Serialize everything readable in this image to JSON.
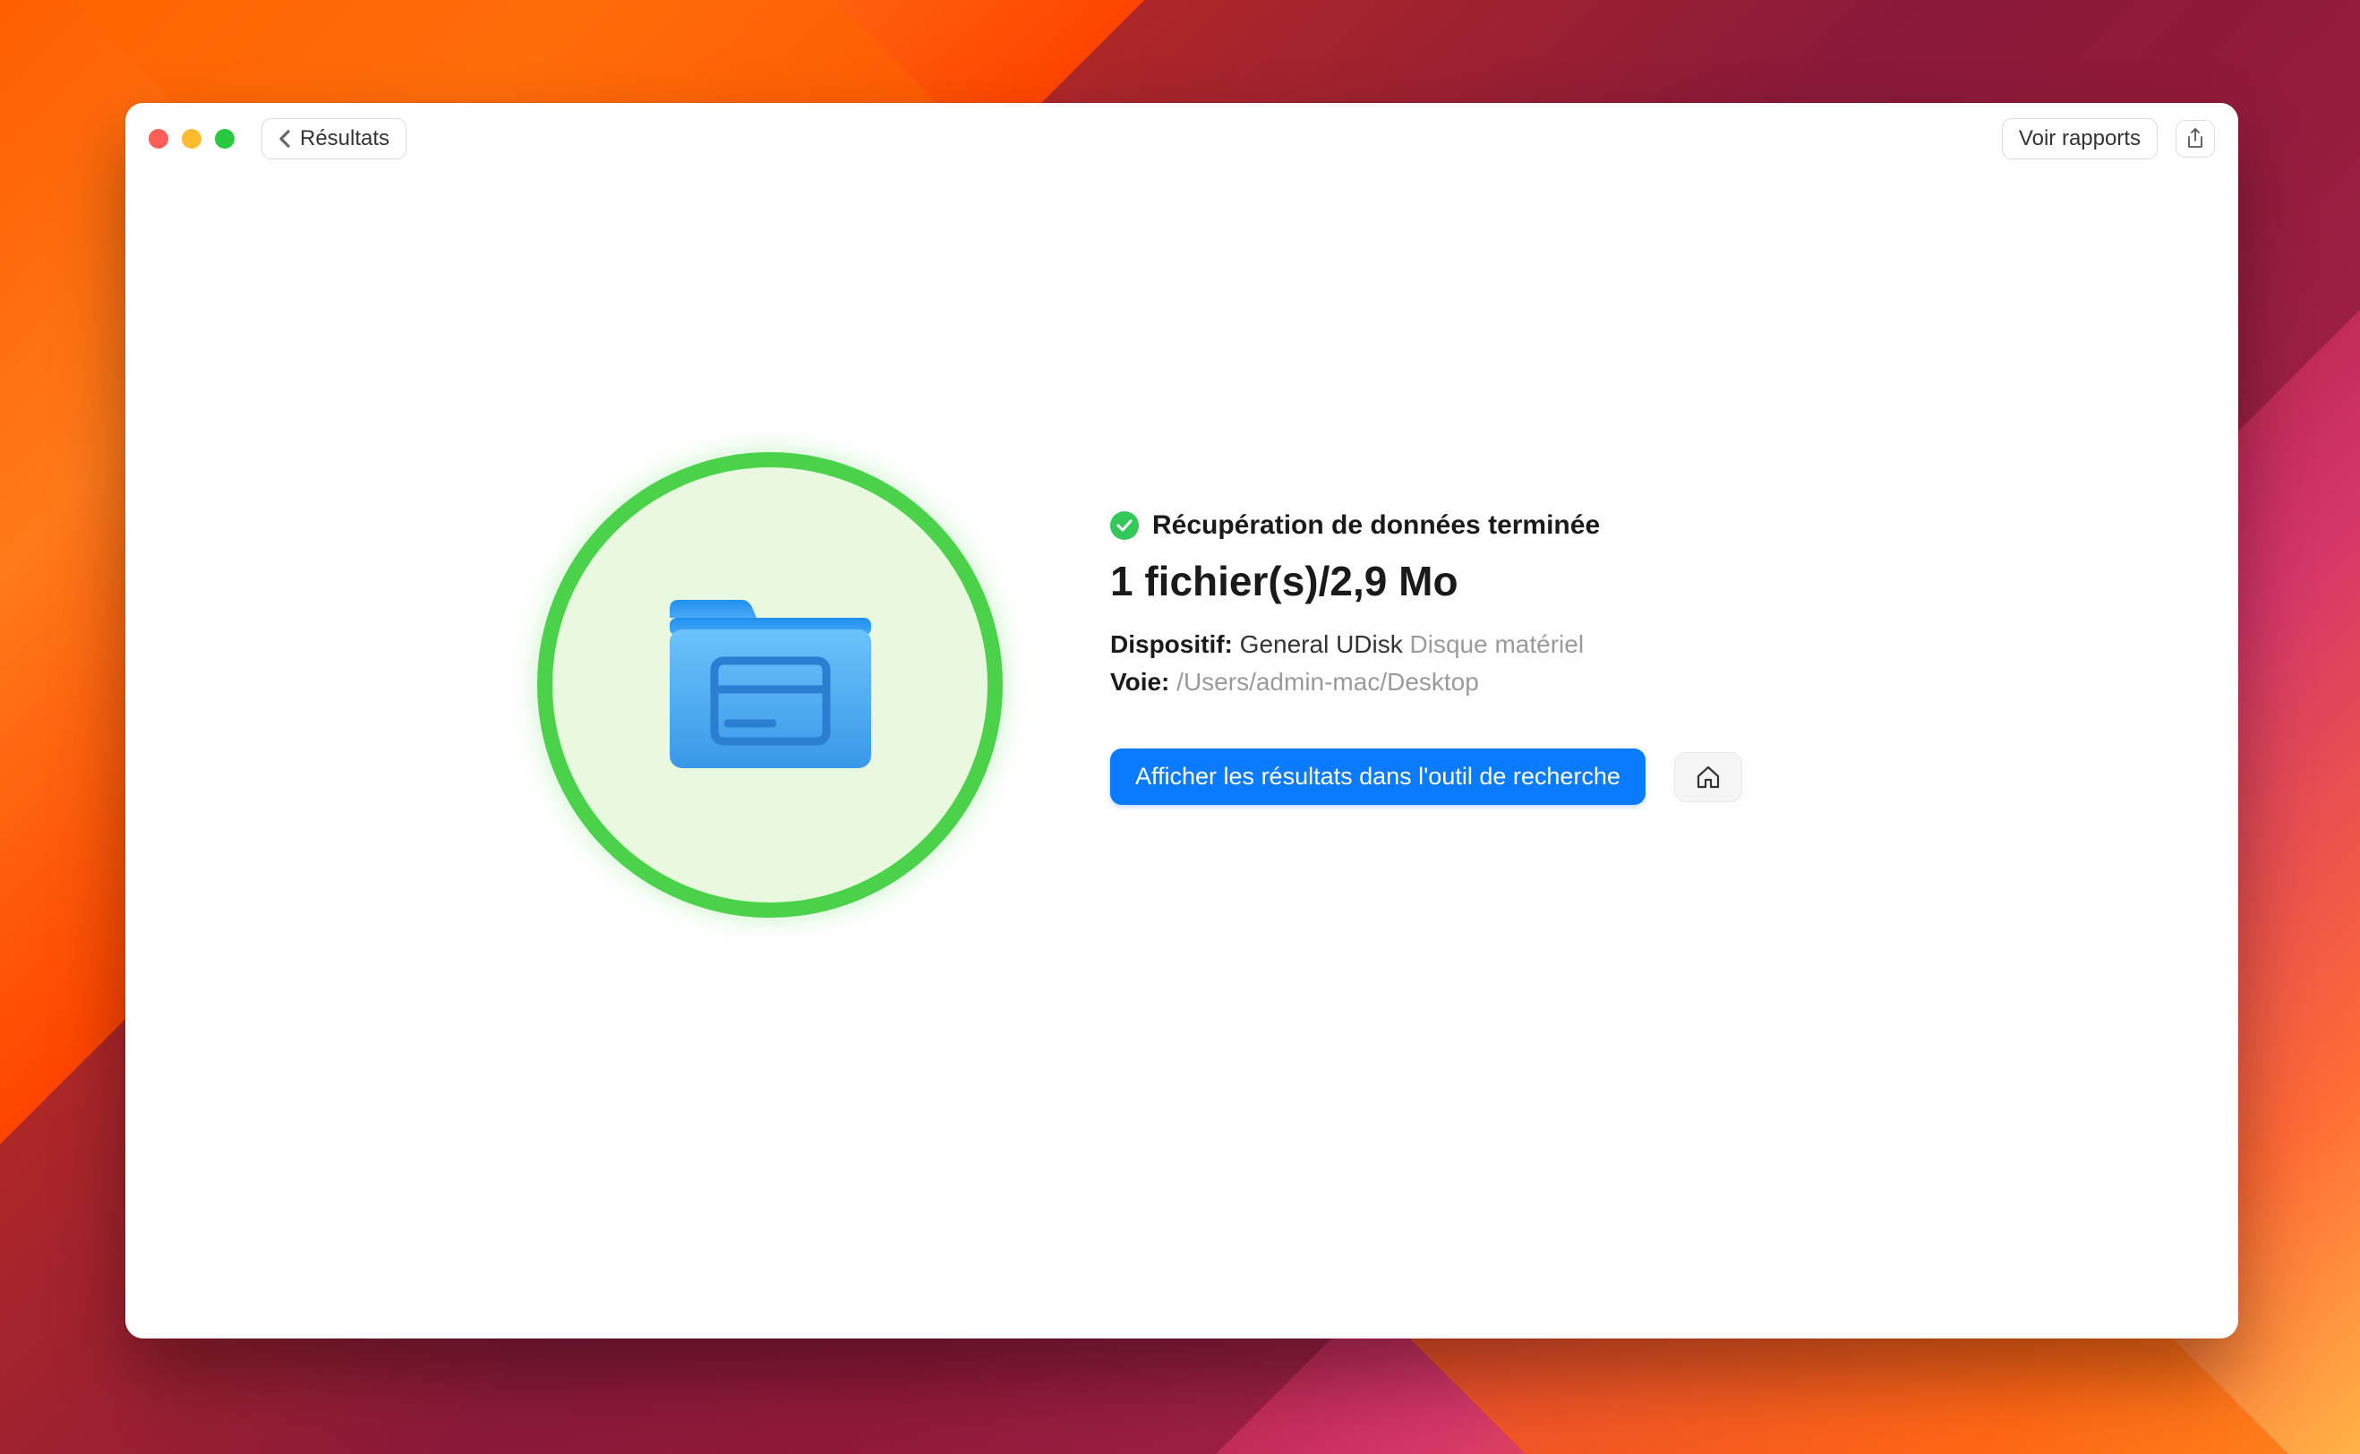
{
  "titlebar": {
    "back_label": "Résultats",
    "reports_label": "Voir rapports"
  },
  "status": {
    "message": "Récupération de données terminée"
  },
  "summary": "1 fichier(s)/2,9 Mo",
  "device": {
    "label": "Dispositif:",
    "name": "General UDisk",
    "type": "Disque matériel"
  },
  "path": {
    "label": "Voie:",
    "value": "/Users/admin-mac/Desktop"
  },
  "actions": {
    "show_in_finder": "Afficher les résultats dans l'outil de recherche"
  },
  "colors": {
    "success_green": "#34c759",
    "circle_green": "#4ad24a",
    "primary_blue": "#0a7aff",
    "folder_blue": "#4aa8f5"
  }
}
